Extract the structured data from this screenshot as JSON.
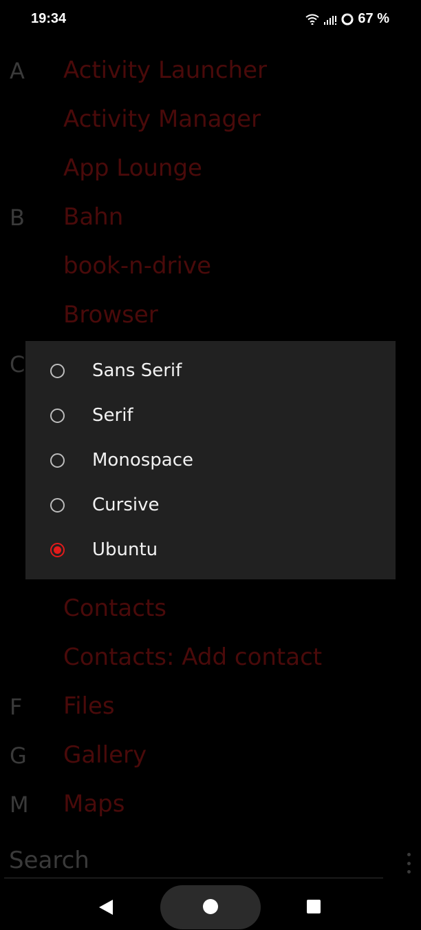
{
  "status": {
    "time": "19:34",
    "battery": "67 %",
    "icons": [
      "wifi-icon",
      "signal-icon",
      "battery-ring-icon"
    ]
  },
  "drawer": {
    "letters": [
      "A",
      "B",
      "C",
      "F",
      "G",
      "M"
    ],
    "apps": [
      "Activity Launcher",
      "Activity Manager",
      "App Lounge",
      "Bahn",
      "book-n-drive",
      "Browser",
      "Contacts",
      "Contacts: Add contact",
      "Files",
      "Gallery",
      "Maps"
    ]
  },
  "search": {
    "placeholder": "Search"
  },
  "font_dialog": {
    "options": [
      "Sans Serif",
      "Serif",
      "Monospace",
      "Cursive",
      "Ubuntu"
    ],
    "selected": "Ubuntu",
    "accent": "#e31b1b"
  },
  "colors": {
    "app_label": "#4a0a0a",
    "letter": "#3a3a3a",
    "dialog_bg": "#212121"
  }
}
